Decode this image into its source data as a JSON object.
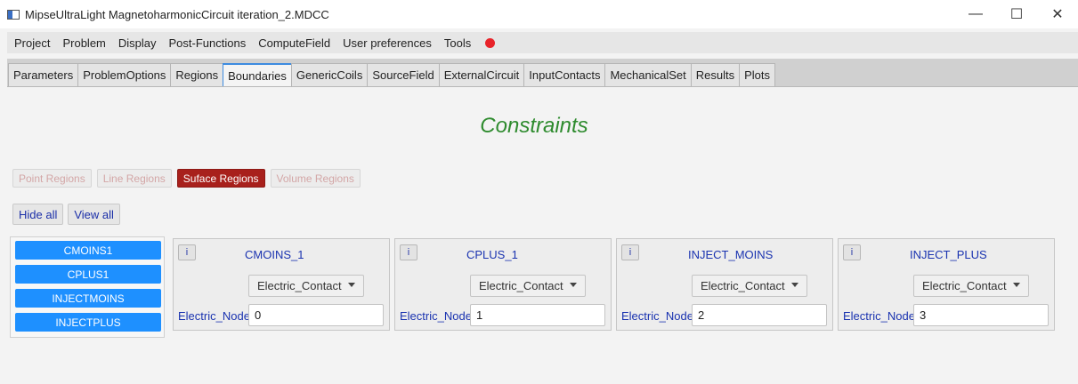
{
  "window": {
    "title": "MipseUltraLight MagnetoharmonicCircuit iteration_2.MDCC",
    "icon": "app-window-icon",
    "controls": {
      "minimize": "—",
      "maximize": "☐",
      "close": "✕"
    }
  },
  "menu": {
    "items": [
      "Project",
      "Problem",
      "Display",
      "Post-Functions",
      "ComputeField",
      "User preferences",
      "Tools"
    ],
    "record_indicator_color": "#e8232a"
  },
  "tabs": {
    "items": [
      "Parameters",
      "ProblemOptions",
      "Regions",
      "Boundaries",
      "GenericCoils",
      "SourceField",
      "ExternalCircuit",
      "InputContacts",
      "MechanicalSet",
      "Results",
      "Plots"
    ],
    "active": "Boundaries"
  },
  "heading": "Constraints",
  "region_types": {
    "items": [
      "Point Regions",
      "Line Regions",
      "Suface Regions",
      "Volume Regions"
    ],
    "active": "Suface Regions",
    "active_color": "#a8201c"
  },
  "view_buttons": {
    "hide_all": "Hide all",
    "view_all": "View all"
  },
  "region_list": [
    "CMOINS1",
    "CPLUS1",
    "INJECTMOINS",
    "INJECTPLUS"
  ],
  "contacts": [
    {
      "info": "i",
      "name": "CMOINS_1",
      "type": "Electric_Contact",
      "node_label": "Electric_Node",
      "node_value": "0"
    },
    {
      "info": "i",
      "name": "CPLUS_1",
      "type": "Electric_Contact",
      "node_label": "Electric_Node",
      "node_value": "1"
    },
    {
      "info": "i",
      "name": "INJECT_MOINS",
      "type": "Electric_Contact",
      "node_label": "Electric_Node",
      "node_value": "2"
    },
    {
      "info": "i",
      "name": "INJECT_PLUS",
      "type": "Electric_Contact",
      "node_label": "Electric_Node",
      "node_value": "3"
    }
  ],
  "colors": {
    "heading": "#2e8b2e",
    "list_button": "#1e90ff",
    "label_blue": "#1a33b0"
  }
}
